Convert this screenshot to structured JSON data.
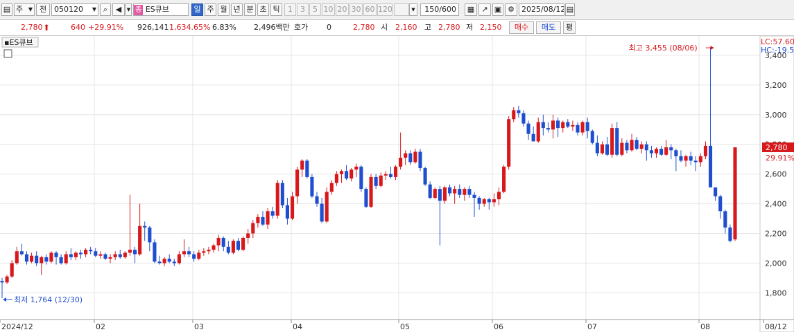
{
  "toolbar": {
    "period_label": "주",
    "prev_label": "전",
    "code": "050120",
    "badge": "종",
    "stock_name": "ES큐브",
    "period_buttons": [
      "일",
      "주",
      "월",
      "년",
      "분",
      "초",
      "틱"
    ],
    "interval_buttons": [
      "1",
      "3",
      "5",
      "10",
      "20",
      "30",
      "60",
      "120"
    ],
    "count": "150/600",
    "date": "2025/08/12"
  },
  "quote": {
    "price": "2,780",
    "change": "640",
    "change_pct": "+29.91%",
    "volume": "926,141",
    "volume_pct": "1,634.65%",
    "turnover": "6.83%",
    "amount": "2,496백만",
    "hoga_label": "호가",
    "hoga_value": "0",
    "hoga_price": "2,780",
    "open_label": "시",
    "open": "2,160",
    "high_label": "고",
    "high": "2,780",
    "low_label": "저",
    "low": "2,150",
    "buy_label": "매수",
    "sell_label": "매도",
    "eval_label": "평"
  },
  "colors": {
    "up": "#d7191c",
    "down": "#1f4fcf",
    "grid": "#e6e6e6",
    "toolbar_bg": "#f0f0f0"
  },
  "chart_data": {
    "type": "candlestick",
    "title": "ES큐브",
    "ylim": [
      1700,
      3500
    ],
    "y_ticks": [
      "1,800",
      "2,000",
      "2,200",
      "2,400",
      "2,600",
      "2,800",
      "3,000",
      "3,200",
      "3,400"
    ],
    "x_ticks": [
      "2024/12",
      "02",
      "03",
      "04",
      "05",
      "06",
      "07",
      "08",
      "08/12"
    ],
    "annotations": {
      "high": "최고 3,455 (08/06)",
      "low": "최저 1,764 (12/30)",
      "lc": "LC:57.60",
      "hc": "HC:-19.5",
      "last_price": "2,780",
      "last_pct": "29.91%"
    },
    "candles": [
      [
        1880,
        1900,
        1764,
        1870
      ],
      [
        1870,
        1920,
        1860,
        1910
      ],
      [
        1910,
        2020,
        1900,
        2000
      ],
      [
        2000,
        2110,
        1990,
        2080
      ],
      [
        2080,
        2130,
        2050,
        2060
      ],
      [
        2060,
        2080,
        1990,
        2010
      ],
      [
        2010,
        2070,
        2000,
        2050
      ],
      [
        2050,
        2080,
        1980,
        2000
      ],
      [
        2000,
        2050,
        1920,
        2040
      ],
      [
        2040,
        2060,
        1990,
        2010
      ],
      [
        2010,
        2080,
        2000,
        2070
      ],
      [
        2070,
        2080,
        1990,
        2040
      ],
      [
        2040,
        2060,
        1990,
        2000
      ],
      [
        2000,
        2080,
        1990,
        2060
      ],
      [
        2060,
        2100,
        2020,
        2040
      ],
      [
        2040,
        2080,
        2020,
        2070
      ],
      [
        2070,
        2090,
        2030,
        2060
      ],
      [
        2060,
        2100,
        2040,
        2090
      ],
      [
        2090,
        2110,
        2060,
        2080
      ],
      [
        2080,
        2100,
        2040,
        2050
      ],
      [
        2050,
        2080,
        2030,
        2060
      ],
      [
        2060,
        2070,
        2020,
        2030
      ],
      [
        2030,
        2060,
        2000,
        2040
      ],
      [
        2040,
        2080,
        2020,
        2060
      ],
      [
        2060,
        2090,
        2030,
        2040
      ],
      [
        2040,
        2080,
        2030,
        2070
      ],
      [
        2070,
        2460,
        2050,
        2090
      ],
      [
        2090,
        2110,
        2000,
        2060
      ],
      [
        2060,
        2400,
        2050,
        2250
      ],
      [
        2250,
        2280,
        2150,
        2240
      ],
      [
        2240,
        2250,
        2080,
        2140
      ],
      [
        2140,
        2160,
        2000,
        2010
      ],
      [
        2010,
        2050,
        1990,
        2000
      ],
      [
        2000,
        2040,
        1980,
        2030
      ],
      [
        2030,
        2060,
        2000,
        2010
      ],
      [
        2010,
        2030,
        1980,
        2000
      ],
      [
        2000,
        2080,
        1990,
        2060
      ],
      [
        2060,
        2160,
        2040,
        2080
      ],
      [
        2080,
        2110,
        2040,
        2060
      ],
      [
        2060,
        2080,
        2010,
        2030
      ],
      [
        2030,
        2090,
        2020,
        2070
      ],
      [
        2070,
        2100,
        2050,
        2080
      ],
      [
        2080,
        2110,
        2060,
        2090
      ],
      [
        2090,
        2130,
        2070,
        2120
      ],
      [
        2120,
        2190,
        2080,
        2170
      ],
      [
        2170,
        2180,
        2080,
        2110
      ],
      [
        2110,
        2150,
        2060,
        2070
      ],
      [
        2070,
        2160,
        2060,
        2150
      ],
      [
        2150,
        2170,
        2080,
        2090
      ],
      [
        2090,
        2180,
        2080,
        2170
      ],
      [
        2170,
        2230,
        2130,
        2200
      ],
      [
        2200,
        2290,
        2170,
        2270
      ],
      [
        2270,
        2330,
        2240,
        2310
      ],
      [
        2310,
        2350,
        2250,
        2260
      ],
      [
        2260,
        2370,
        2230,
        2350
      ],
      [
        2350,
        2380,
        2300,
        2320
      ],
      [
        2320,
        2560,
        2300,
        2540
      ],
      [
        2540,
        2560,
        2370,
        2390
      ],
      [
        2390,
        2440,
        2260,
        2300
      ],
      [
        2300,
        2480,
        2290,
        2450
      ],
      [
        2450,
        2650,
        2400,
        2630
      ],
      [
        2630,
        2700,
        2580,
        2690
      ],
      [
        2690,
        2700,
        2570,
        2580
      ],
      [
        2580,
        2600,
        2440,
        2450
      ],
      [
        2450,
        2480,
        2380,
        2400
      ],
      [
        2400,
        2440,
        2270,
        2280
      ],
      [
        2280,
        2510,
        2270,
        2480
      ],
      [
        2480,
        2560,
        2460,
        2540
      ],
      [
        2540,
        2620,
        2520,
        2600
      ],
      [
        2600,
        2630,
        2540,
        2620
      ],
      [
        2620,
        2660,
        2560,
        2570
      ],
      [
        2570,
        2640,
        2550,
        2630
      ],
      [
        2630,
        2670,
        2580,
        2650
      ],
      [
        2650,
        2660,
        2480,
        2500
      ],
      [
        2500,
        2510,
        2370,
        2380
      ],
      [
        2380,
        2600,
        2370,
        2580
      ],
      [
        2580,
        2600,
        2500,
        2520
      ],
      [
        2520,
        2610,
        2510,
        2590
      ],
      [
        2590,
        2620,
        2560,
        2600
      ],
      [
        2600,
        2650,
        2570,
        2580
      ],
      [
        2580,
        2660,
        2560,
        2650
      ],
      [
        2650,
        2880,
        2630,
        2710
      ],
      [
        2710,
        2760,
        2660,
        2740
      ],
      [
        2740,
        2760,
        2660,
        2680
      ],
      [
        2680,
        2770,
        2670,
        2750
      ],
      [
        2750,
        2770,
        2620,
        2640
      ],
      [
        2640,
        2650,
        2520,
        2530
      ],
      [
        2530,
        2550,
        2430,
        2440
      ],
      [
        2440,
        2510,
        2430,
        2500
      ],
      [
        2500,
        2520,
        2120,
        2420
      ],
      [
        2420,
        2520,
        2400,
        2510
      ],
      [
        2510,
        2530,
        2450,
        2470
      ],
      [
        2470,
        2520,
        2400,
        2500
      ],
      [
        2500,
        2530,
        2440,
        2460
      ],
      [
        2460,
        2510,
        2420,
        2500
      ],
      [
        2500,
        2520,
        2440,
        2460
      ],
      [
        2460,
        2480,
        2310,
        2440
      ],
      [
        2440,
        2450,
        2360,
        2400
      ],
      [
        2400,
        2440,
        2380,
        2430
      ],
      [
        2430,
        2440,
        2360,
        2410
      ],
      [
        2410,
        2470,
        2380,
        2430
      ],
      [
        2430,
        2510,
        2390,
        2480
      ],
      [
        2480,
        2660,
        2470,
        2650
      ],
      [
        2650,
        2990,
        2630,
        2970
      ],
      [
        2970,
        3050,
        2950,
        3030
      ],
      [
        3030,
        3060,
        2980,
        3010
      ],
      [
        3010,
        3030,
        2920,
        2940
      ],
      [
        2940,
        2960,
        2830,
        2870
      ],
      [
        2870,
        2920,
        2820,
        2820
      ],
      [
        2820,
        2980,
        2810,
        2950
      ],
      [
        2950,
        3000,
        2860,
        2910
      ],
      [
        2910,
        2950,
        2880,
        2900
      ],
      [
        2900,
        3000,
        2840,
        2960
      ],
      [
        2960,
        2980,
        2850,
        2910
      ],
      [
        2910,
        2960,
        2880,
        2950
      ],
      [
        2950,
        2970,
        2910,
        2920
      ],
      [
        2920,
        2960,
        2890,
        2930
      ],
      [
        2930,
        2950,
        2860,
        2880
      ],
      [
        2880,
        2960,
        2860,
        2950
      ],
      [
        2950,
        2980,
        2840,
        2890
      ],
      [
        2890,
        2900,
        2800,
        2810
      ],
      [
        2810,
        2860,
        2720,
        2740
      ],
      [
        2740,
        2820,
        2730,
        2800
      ],
      [
        2800,
        2850,
        2720,
        2730
      ],
      [
        2730,
        2940,
        2710,
        2910
      ],
      [
        2910,
        2950,
        2720,
        2730
      ],
      [
        2730,
        2840,
        2720,
        2810
      ],
      [
        2810,
        2830,
        2740,
        2760
      ],
      [
        2760,
        2870,
        2750,
        2830
      ],
      [
        2830,
        2850,
        2760,
        2770
      ],
      [
        2770,
        2820,
        2740,
        2800
      ],
      [
        2800,
        2820,
        2690,
        2760
      ],
      [
        2760,
        2790,
        2710,
        2740
      ],
      [
        2740,
        2780,
        2710,
        2770
      ],
      [
        2770,
        2790,
        2720,
        2730
      ],
      [
        2730,
        2830,
        2720,
        2780
      ],
      [
        2780,
        2800,
        2700,
        2760
      ],
      [
        2760,
        2770,
        2620,
        2720
      ],
      [
        2720,
        2760,
        2680,
        2690
      ],
      [
        2690,
        2730,
        2650,
        2720
      ],
      [
        2720,
        2750,
        2660,
        2690
      ],
      [
        2690,
        2720,
        2620,
        2680
      ],
      [
        2680,
        2740,
        2650,
        2720
      ],
      [
        2720,
        2820,
        2700,
        2790
      ],
      [
        2790,
        3455,
        2560,
        2510
      ],
      [
        2510,
        2470,
        2420,
        2450
      ],
      [
        2450,
        2460,
        2300,
        2350
      ],
      [
        2350,
        2360,
        2200,
        2240
      ],
      [
        2240,
        2260,
        2140,
        2150
      ],
      [
        2160,
        2780,
        2150,
        2780
      ]
    ]
  }
}
